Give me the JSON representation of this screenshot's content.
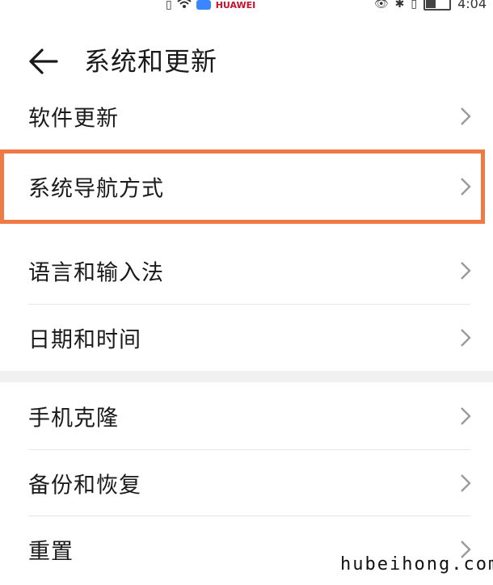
{
  "status_bar": {
    "time": "4:04",
    "carrier_logo": "HUAWEI",
    "icons": [
      "sim-icon",
      "wifi-icon",
      "cloud-icon",
      "huawei-logo",
      "eye-icon",
      "bluetooth-icon",
      "vibrate-icon",
      "battery-icon"
    ]
  },
  "header": {
    "back_icon": "arrow-left-icon",
    "title": "系统和更新"
  },
  "list": {
    "items": [
      {
        "label": "软件更新"
      },
      {
        "label": "系统导航方式"
      },
      {
        "label": "语言和输入法"
      },
      {
        "label": "日期和时间"
      },
      {
        "label": "手机克隆"
      },
      {
        "label": "备份和恢复"
      },
      {
        "label": "重置"
      }
    ]
  },
  "highlight": {
    "color": "#f07a45"
  },
  "watermark": "hubeihong.com"
}
